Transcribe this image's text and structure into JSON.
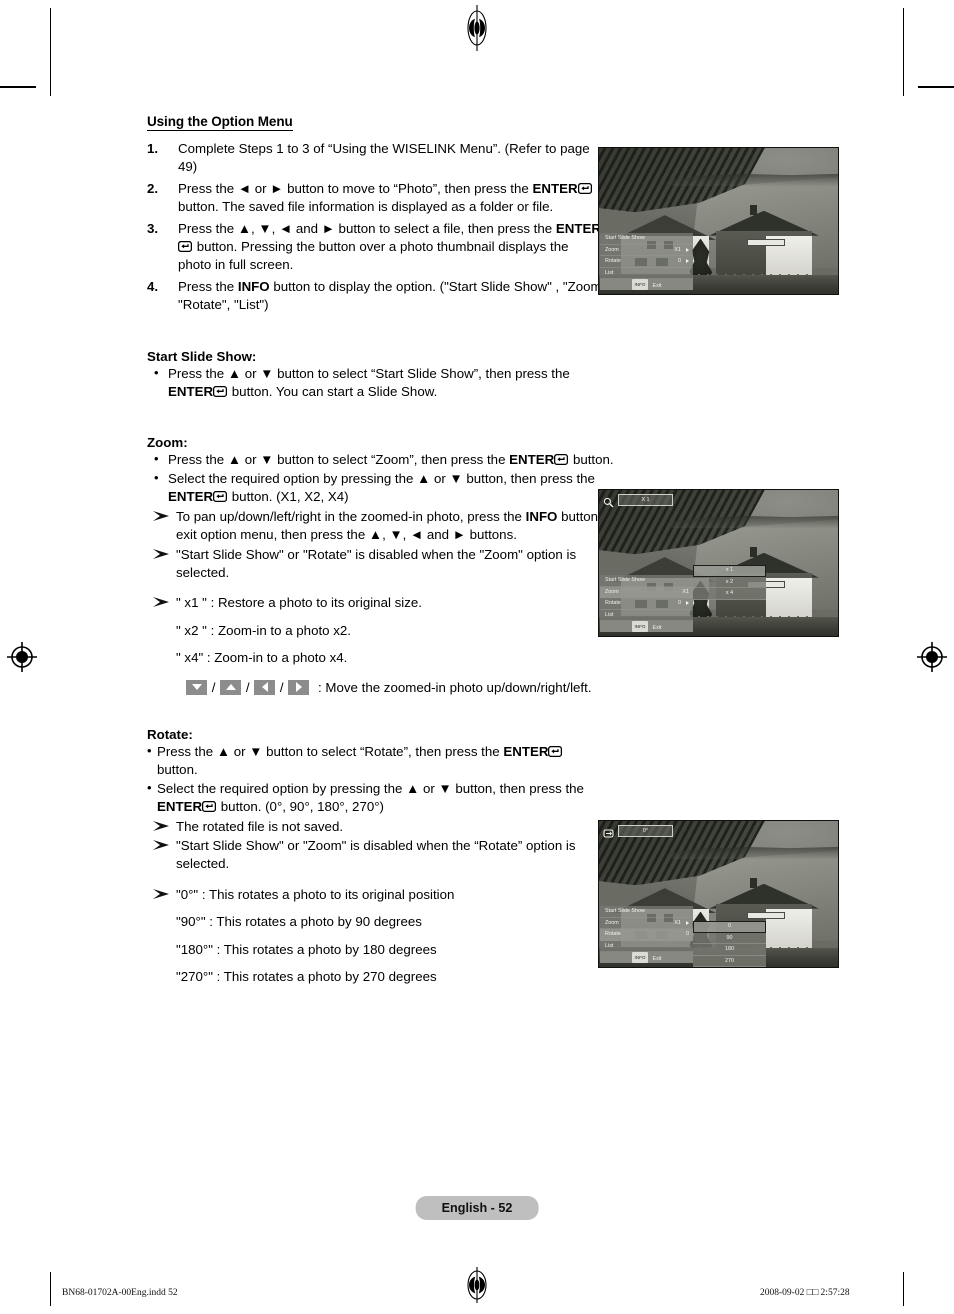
{
  "document": {
    "section_title": "Using the Option Menu",
    "page_badge": "English - 52",
    "footer_left": "BN68-01702A-00Eng.indd   52",
    "footer_right": "2008-09-02   □□ 2:57:28"
  },
  "steps": [
    {
      "num": "1.",
      "text_a": "Complete Steps 1 to 3 of “Using the WISELINK Menu”. (Refer to page 49)"
    },
    {
      "num": "2.",
      "text_a": "Press the ◄ or ► button to move to “Photo”, then press the ",
      "bold_b": "ENTER",
      "text_c": " button. The saved file information is displayed as a folder or file."
    },
    {
      "num": "3.",
      "text_a": "Press the ▲, ▼, ◄ and ► button to select a file, then press the ",
      "bold_b": "ENTER",
      "text_c": " button. Pressing the button over a photo thumbnail displays the photo in full screen."
    },
    {
      "num": "4.",
      "text_a": "Press the ",
      "bold_b": "INFO",
      "text_c": " button to display the option. (\"Start Slide Show\" , \"Zoom\", \"Rotate\", \"List\")"
    }
  ],
  "slideshow": {
    "heading": "Start Slide Show:",
    "bullet_a": "Press the ▲ or ▼ button to select “Start Slide Show”, then press the ",
    "bullet_bold": "ENTER",
    "bullet_c": " button. You can start a Slide Show."
  },
  "zoom": {
    "heading": "Zoom:",
    "b1_a": "Press the ▲ or ▼ button to select “Zoom”, then press the ",
    "b1_bold": "ENTER",
    "b1_c": " button.",
    "b2_a": "Select the required option by pressing the ▲ or ▼ button, then press the ",
    "b2_bold": "ENTER",
    "b2_c": " button. (X1, X2, X4)",
    "note1_a": "To pan up/down/left/right in the zoomed-in photo, press the ",
    "note1_bold": "INFO",
    "note1_c": " button to exit option menu, then press the ▲, ▼, ◄ and ► buttons.",
    "note2": "\"Start Slide Show\" or \"Rotate\" is disabled when the \"Zoom\" option is selected.",
    "note3": "\" x1 \" : Restore a photo to its original size.",
    "note4": "\" x2 \" : Zoom-in to a photo x2.",
    "note5": "\" x4\"  : Zoom-in to a photo x4.",
    "note6_tail": ": Move the zoomed-in photo up/down/right/left.",
    "slash": "/"
  },
  "rotate": {
    "heading": "Rotate:",
    "b1_a": "Press the ▲ or ▼ button to select “Rotate”, then press the ",
    "b1_bold": "ENTER",
    "b1_c": " button.",
    "b2_a": "Select the required option by pressing the ▲ or ▼ button, then press the ",
    "b2_bold": "ENTER",
    "b2_c": " button. (0°, 90°, 180°, 270°)",
    "note1": "The rotated file is not saved.",
    "note2": "\"Start Slide Show\" or \"Zoom\" is disabled when the “Rotate” option is selected.",
    "note3": "\"0°\" : This rotates a photo to its original position",
    "note4": "\"90°\" : This rotates a photo by 90 degrees",
    "note5": "\"180°\" : This rotates a photo by 180 degrees",
    "note6": "\"270°\" : This rotates a photo by 270 degrees"
  },
  "screenshots": {
    "osd_menu": {
      "items": [
        {
          "label": "Start Slide Show",
          "value": ""
        },
        {
          "label": "Zoom",
          "value": "X1"
        },
        {
          "label": "Rotate",
          "value": "0"
        },
        {
          "label": "List",
          "value": ""
        }
      ],
      "footer_key": "INFO",
      "footer_label": "Exit"
    },
    "shot1": {
      "caption": "option menu over photo"
    },
    "shot2": {
      "badge_value": "X 1",
      "badge_icon": "magnifier-icon",
      "submenu": [
        "x 1",
        "x 2",
        "x 4"
      ],
      "submenu_selected": "x 1",
      "osd_items": [
        {
          "label": "Start Slide Show",
          "value": ""
        },
        {
          "label": "Zoom",
          "value": "X1"
        },
        {
          "label": "Rotate",
          "value": "0"
        },
        {
          "label": "List",
          "value": ""
        }
      ]
    },
    "shot3": {
      "badge_value": "0°",
      "badge_icon": "rotate-icon",
      "submenu": [
        "0",
        "90",
        "180",
        "270"
      ],
      "submenu_selected": "0",
      "osd_items": [
        {
          "label": "Start Slide Show",
          "value": ""
        },
        {
          "label": "Zoom",
          "value": "X1"
        },
        {
          "label": "Rotate",
          "value": "0"
        },
        {
          "label": "List",
          "value": ""
        }
      ]
    }
  },
  "colors": {
    "page_badge_bg": "#bfbfbf",
    "key_bg": "#8c8c8c",
    "osd_bg": "#767870"
  }
}
